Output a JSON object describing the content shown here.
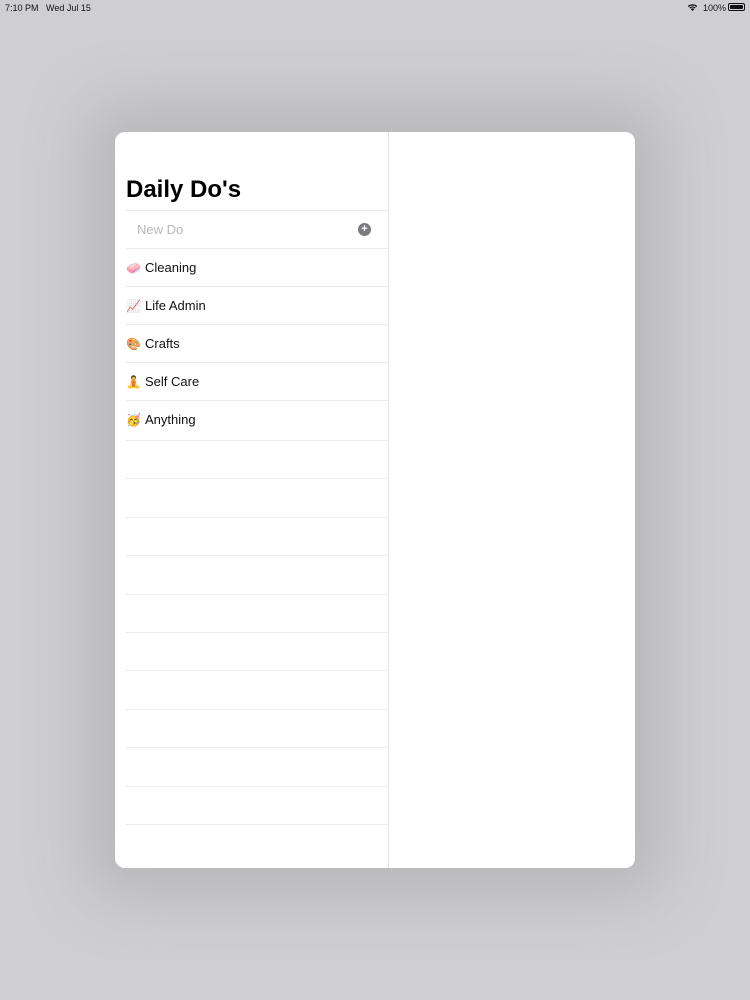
{
  "status_bar": {
    "time": "7:10 PM",
    "date": "Wed Jul 15",
    "battery": "100%",
    "battery_level": 1.0
  },
  "app": {
    "title": "Daily Do's",
    "new_item_placeholder": "New Do",
    "add_icon": "plus-circle-icon",
    "categories": [
      {
        "emoji": "🧼",
        "label": "Cleaning"
      },
      {
        "emoji": "📈",
        "label": "Life Admin"
      },
      {
        "emoji": "🎨",
        "label": "Crafts"
      },
      {
        "emoji": "🧘",
        "label": "Self Care"
      },
      {
        "emoji": "🥳",
        "label": "Anything"
      }
    ]
  }
}
